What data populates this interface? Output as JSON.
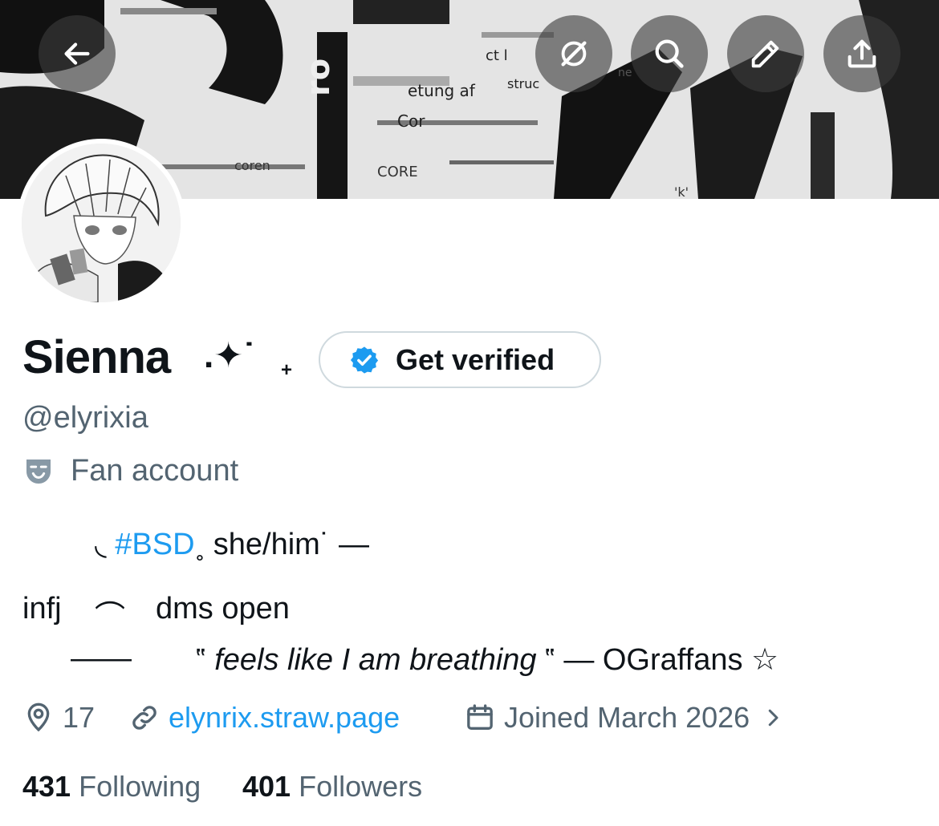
{
  "header": {
    "back_icon": "arrow-left-icon",
    "actions": [
      "grok-icon",
      "search-icon",
      "edit-pencil-icon",
      "share-upload-icon"
    ]
  },
  "banner": {
    "text_fragments": [
      "ct l",
      "ro",
      "etung af",
      "struc",
      "ne",
      "Cor",
      "coren",
      "CORE",
      "'k'"
    ]
  },
  "profile": {
    "name": "Sienna",
    "name_decoration": ".✦˙",
    "name_plus": "+",
    "verify_label": "Get verified",
    "handle": "@elyrixia",
    "category_label": "Fan account"
  },
  "bio": {
    "line1_prefix": "◟",
    "line1_tag": "#BSD",
    "line1_sep": "˳",
    "line1_text": "she/him",
    "line1_suffix": "˙ —",
    "line2_a": "infj",
    "line2_b": "⌒",
    "line2_c": "dms open",
    "line3_dash": "——",
    "line3_open": "‟",
    "line3_quote": "feels like I am breathing",
    "line3_close": "‟ — OGraffans ☆"
  },
  "meta": {
    "location": "17",
    "link": "elynrix.straw.page",
    "joined": "Joined March 2026"
  },
  "stats": {
    "following_count": "431",
    "following_label": "Following",
    "followers_count": "401",
    "followers_label": "Followers"
  },
  "colors": {
    "accent": "#1d9bf0",
    "secondary_text": "#536471",
    "primary_text": "#0f1419",
    "border": "#cfd9de"
  }
}
